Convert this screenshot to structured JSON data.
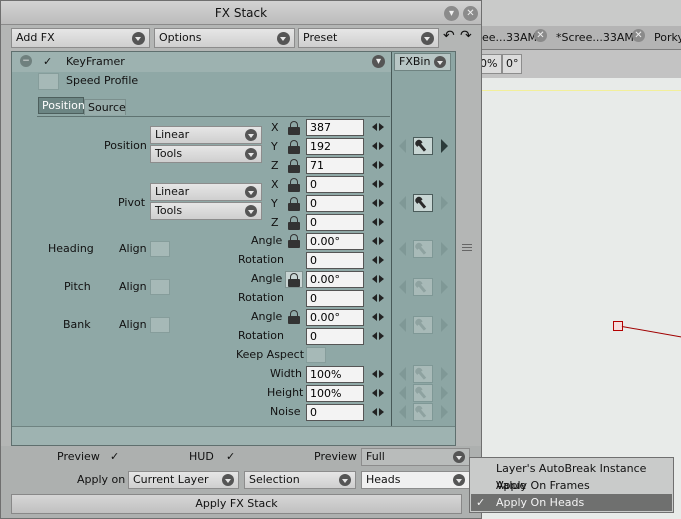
{
  "window": {
    "title": "FX Stack"
  },
  "toolbar": {
    "add_fx": "Add FX",
    "options": "Options",
    "preset": "Preset"
  },
  "background_app": {
    "tabs": [
      "ee...33AM",
      "*Scree...33AM",
      "Porky"
    ],
    "fields": [
      "0%",
      "0°"
    ]
  },
  "effect": {
    "name": "KeyFramer",
    "speed_profile": "Speed Profile",
    "fxbin": "FXBin",
    "tabs": [
      "Position",
      "Source"
    ]
  },
  "position": {
    "label": "Position",
    "mode": "Linear",
    "tool": "Tools",
    "x_label": "X",
    "y_label": "Y",
    "z_label": "Z",
    "x": "387",
    "y": "192",
    "z": "71"
  },
  "pivot": {
    "label": "Pivot",
    "mode": "Linear",
    "tool": "Tools",
    "x_label": "X",
    "y_label": "Y",
    "z_label": "Z",
    "x": "0",
    "y": "0",
    "z": "0"
  },
  "heading": {
    "label": "Heading",
    "align": "Align",
    "angle_label": "Angle",
    "angle": "0.00°",
    "rotation_label": "Rotation",
    "rotation": "0"
  },
  "pitch": {
    "label": "Pitch",
    "align": "Align",
    "angle_label": "Angle",
    "angle": "0.00°",
    "rotation_label": "Rotation",
    "rotation": "0"
  },
  "bank": {
    "label": "Bank",
    "align": "Align",
    "angle_label": "Angle",
    "angle": "0.00°",
    "rotation_label": "Rotation",
    "rotation": "0"
  },
  "scale": {
    "keep_aspect": "Keep Aspect",
    "width_label": "Width",
    "width": "100%",
    "height_label": "Height",
    "height": "100%",
    "noise_label": "Noise",
    "noise": "0"
  },
  "footer": {
    "preview_label": "Preview",
    "hud_label": "HUD",
    "preview_mode_label": "Preview",
    "preview_mode": "Full",
    "apply_on_label": "Apply on",
    "apply_on": "Current Layer",
    "selection": "Selection",
    "heads": "Heads",
    "apply_button": "Apply FX Stack",
    "check": "✓"
  },
  "popup": {
    "items": [
      "Layer's AutoBreak Instance Value",
      "Apply On Frames",
      "Apply On Heads"
    ],
    "selected_index": 2
  }
}
